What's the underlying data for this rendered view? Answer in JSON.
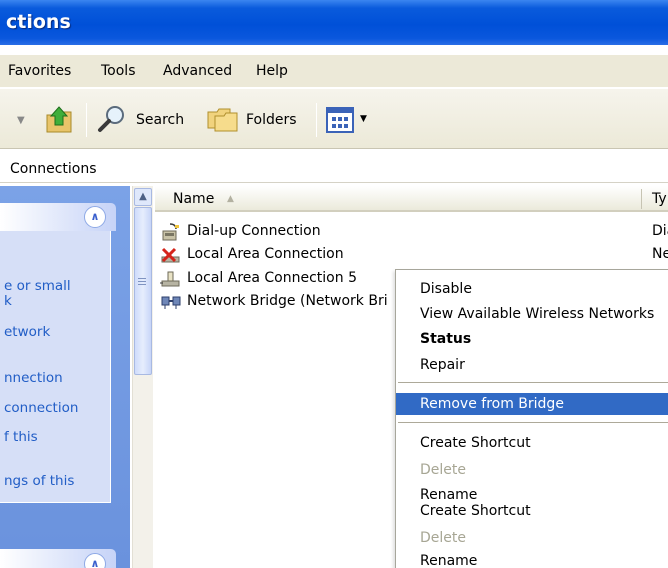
{
  "window": {
    "title": "ctions"
  },
  "menu": {
    "items": [
      "Favorites",
      "Tools",
      "Advanced",
      "Help"
    ]
  },
  "toolbar": {
    "search_label": "Search",
    "folders_label": "Folders"
  },
  "address": {
    "value": "Connections"
  },
  "tasks": {
    "items": [
      "e or small",
      "k",
      "etwork",
      "nnection",
      "connection",
      "f this",
      "ngs of this"
    ]
  },
  "list": {
    "columns": {
      "name": "Name",
      "type": "Ty"
    },
    "rows": [
      {
        "name": "Dial-up Connection",
        "type": "Dia",
        "icon": "dialup-connection-icon"
      },
      {
        "name": "Local Area Connection",
        "type": "Ne",
        "icon": "disconnected-lan-icon"
      },
      {
        "name": "Local Area Connection 5",
        "type": "",
        "icon": "lan-connection-icon"
      },
      {
        "name": "Network Bridge (Network Bri",
        "type": "",
        "icon": "network-bridge-icon"
      }
    ]
  },
  "context_menu": {
    "items": [
      {
        "label": "Disable",
        "state": "normal"
      },
      {
        "label": "View Available Wireless Networks",
        "state": "normal"
      },
      {
        "label": "Status",
        "state": "bold"
      },
      {
        "label": "Repair",
        "state": "normal"
      },
      {
        "label": "Remove from Bridge",
        "state": "highlighted"
      },
      {
        "label": "Create Shortcut",
        "state": "normal"
      },
      {
        "label": "Delete",
        "state": "disabled"
      },
      {
        "label": "Rename",
        "state": "normal"
      },
      {
        "label": "Create Shortcut",
        "state": "normal"
      },
      {
        "label": "Delete",
        "state": "disabled"
      },
      {
        "label": "Rename",
        "state": "normal"
      }
    ]
  },
  "colors": {
    "titlebar": "#0050d8",
    "selection": "#316ac5",
    "task_link": "#215dc6",
    "task_pane": "#6a92dd"
  }
}
